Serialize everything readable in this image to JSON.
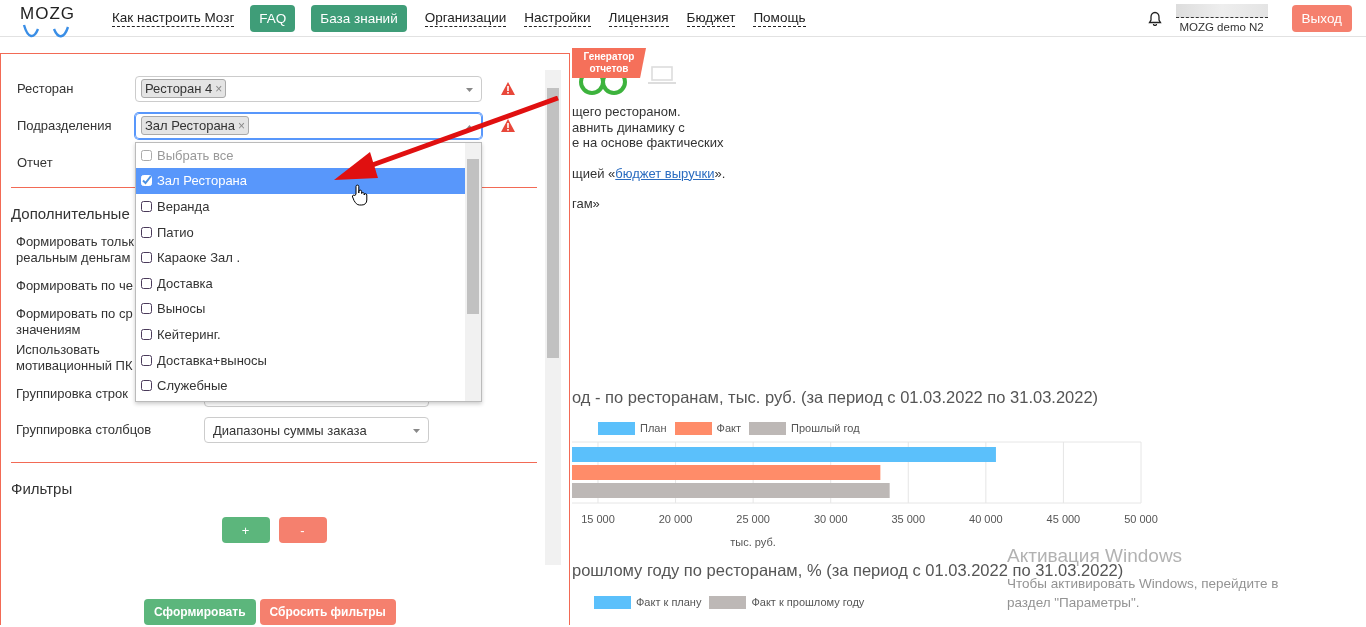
{
  "header": {
    "logo": "MOZG",
    "nav": [
      {
        "label": "Как настроить Мозг",
        "kind": "link"
      },
      {
        "label": "FAQ",
        "kind": "button"
      },
      {
        "label": "База знаний",
        "kind": "button"
      },
      {
        "label": "Организации",
        "kind": "link"
      },
      {
        "label": "Настройки",
        "kind": "link"
      },
      {
        "label": "Лицензия",
        "kind": "link"
      },
      {
        "label": "Бюджет",
        "kind": "link"
      },
      {
        "label": "Помощь",
        "kind": "link"
      }
    ],
    "user": "MOZG demo N2",
    "logout": "Выход"
  },
  "form": {
    "fields": [
      {
        "label": "Ресторан",
        "chips": [
          {
            "label": "Ресторан 4",
            "remove": "×"
          }
        ],
        "focused": false,
        "warning": true
      },
      {
        "label": "Подразделения",
        "chips": [
          {
            "label": "Зал Ресторана",
            "remove": "×"
          }
        ],
        "focused": true,
        "warning": true
      },
      {
        "label": "Отчет"
      }
    ],
    "dropdown": {
      "options": [
        {
          "label": "Выбрать все",
          "kind": "select-all",
          "checked": false,
          "selected": false
        },
        {
          "label": "Зал Ресторана",
          "kind": "option",
          "checked": true,
          "selected": true
        },
        {
          "label": "Веранда",
          "kind": "option",
          "checked": false,
          "selected": false
        },
        {
          "label": "Патио",
          "kind": "option",
          "checked": false,
          "selected": false
        },
        {
          "label": "Караоке Зал .",
          "kind": "option",
          "checked": false,
          "selected": false
        },
        {
          "label": "Доставка",
          "kind": "option",
          "checked": false,
          "selected": false
        },
        {
          "label": "Выносы",
          "kind": "option",
          "checked": false,
          "selected": false
        },
        {
          "label": "Кейтеринг.",
          "kind": "option",
          "checked": false,
          "selected": false
        },
        {
          "label": "Доставка+выносы",
          "kind": "option",
          "checked": false,
          "selected": false
        },
        {
          "label": "Служебные",
          "kind": "option",
          "checked": false,
          "selected": false
        }
      ]
    },
    "section_title": "Дополнительные",
    "options": [
      {
        "label": "Формировать тольк\nреальным деньгам",
        "kind": "text"
      },
      {
        "label": "Формировать по че",
        "kind": "text"
      },
      {
        "label": "Формировать по ср\nзначениям",
        "kind": "text"
      },
      {
        "label": "Использовать\nмотивационный ПК",
        "kind": "text"
      },
      {
        "label": "Группировка строк",
        "kind": "select"
      },
      {
        "label": "Группировка столбцов",
        "kind": "select",
        "value": "Диапазоны суммы заказа"
      }
    ],
    "filters_title": "Фильтры",
    "filter_buttons": [
      {
        "label": "+",
        "kind": "add"
      },
      {
        "label": "-",
        "kind": "remove"
      }
    ],
    "actions": [
      {
        "label": "Сформировать",
        "kind": "primary"
      },
      {
        "label": "Сбросить фильтры",
        "kind": "danger"
      }
    ]
  },
  "report": {
    "badge": "Генератор\nотчетов",
    "intro_paragraphs": [
      {
        "lines": [
          {
            "text": "щего рестораном."
          },
          {
            "text": "авнить динамику с"
          },
          {
            "text": "е на основе фактических"
          }
        ]
      },
      {
        "lines": [
          {
            "text": "щией «",
            "link": "бюджет выручки",
            "after": "»."
          }
        ]
      },
      {
        "lines": [
          {
            "text": "гам»"
          }
        ]
      }
    ],
    "chart1": {
      "chart_data": {
        "type": "bar",
        "orientation": "horizontal",
        "grid": true,
        "title": "од - по ресторанам, тыс. руб. (за период с 01.03.2022 по 31.03.2022)",
        "xlabel": "тыс. руб.",
        "xlim": [
          13325,
          50000
        ],
        "xticks": [
          {
            "value": 15000,
            "label": "15 000"
          },
          {
            "value": 20000,
            "label": "20 000"
          },
          {
            "value": 25000,
            "label": "25 000"
          },
          {
            "value": 30000,
            "label": "30 000"
          },
          {
            "value": 35000,
            "label": "35 000"
          },
          {
            "value": 40000,
            "label": "40 000"
          },
          {
            "value": 45000,
            "label": "45 000"
          },
          {
            "value": 50000,
            "label": "50 000"
          }
        ],
        "series": [
          {
            "name": "План",
            "color": "#5bc0fb",
            "values": [
              40650
            ]
          },
          {
            "name": "Факт",
            "color": "#ff8c69",
            "values": [
              33200
            ]
          },
          {
            "name": "Прошлый год",
            "color": "#bdb8b6",
            "values": [
              33800
            ]
          }
        ]
      }
    },
    "chart2": {
      "title": "рошлому году по ресторанам, % (за период с 01.03.2022 по 31.03.2022)",
      "legend": [
        {
          "name": "Факт к плану",
          "color": "#5bc0fb"
        },
        {
          "name": "Факт к прошлому году",
          "color": "#bdb8b6"
        }
      ]
    }
  },
  "os_notice": {
    "title": "Активация Windows",
    "text": "Чтобы активировать Windows, перейдите в\nраздел \"Параметры\"."
  }
}
